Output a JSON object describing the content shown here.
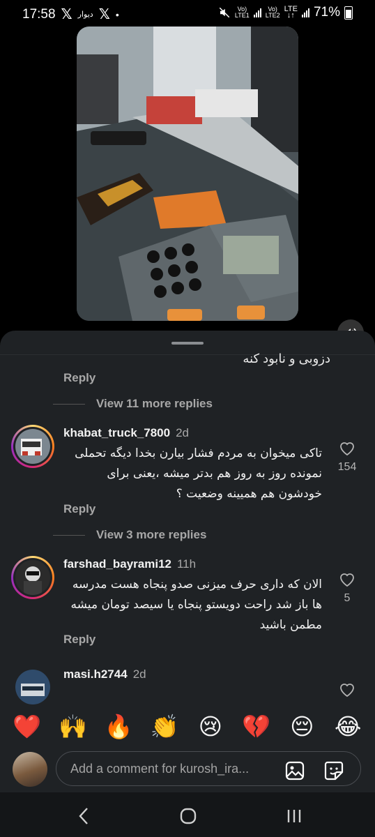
{
  "status_bar": {
    "time": "17:58",
    "app_label": "دیوار",
    "x_glyph": "𝕏",
    "dot": "•",
    "sim1": [
      "Vo)",
      "LTE1"
    ],
    "sim2": [
      "Vo)",
      "LTE2"
    ],
    "network": "LTE",
    "battery": "71%"
  },
  "comments_sheet": {
    "clipped_text": "دزوبی و نابود کنه",
    "reply_label": "Reply",
    "view_more_1": "View 11 more replies",
    "view_more_2": "View 3 more replies",
    "comments": [
      {
        "username": "khabat_truck_7800",
        "time": "2d",
        "text": "تاکی میخوان به مردم فشار بیارن بخدا دیگه تحملی نمونده روز به روز هم بدتر میشه ،یعنی برای خودشون هم همیینه وضعیت ؟",
        "likes": "154"
      },
      {
        "username": "farshad_bayrami12",
        "time": "11h",
        "text": "الان که داری حرف میزنی صدو پنجاه هست مدرسه ها باز شد راحت دویستو پنجاه یا سیصد تومان میشه مطمن باشید",
        "likes": "5"
      },
      {
        "username": "masi.h2744",
        "time": "2d",
        "text": "",
        "likes": ""
      }
    ]
  },
  "reactions": [
    "❤️",
    "🙌",
    "🔥",
    "👏",
    "😢",
    "💔",
    "😔",
    "😂"
  ],
  "comment_input": {
    "placeholder": "Add a comment for kurosh_ira..."
  },
  "colors": {
    "sheet_bg": "#1f2225",
    "secondary_text": "#a8a8a8",
    "story_ring": "#d62976"
  }
}
